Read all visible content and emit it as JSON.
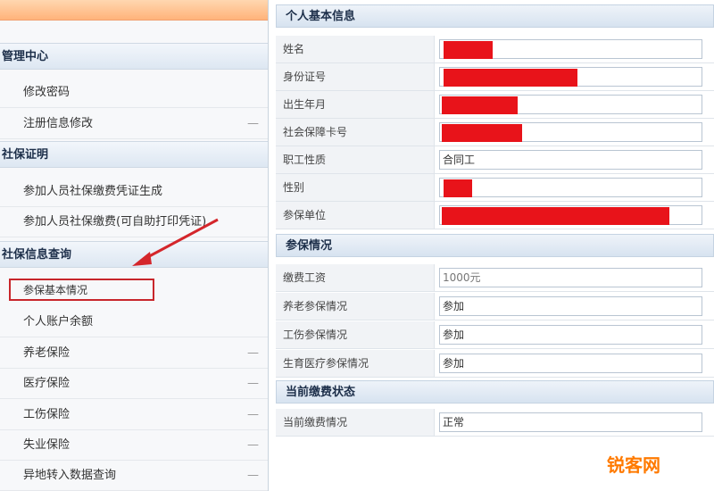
{
  "sidebar": {
    "sections": [
      {
        "title": "管理中心",
        "items": [
          {
            "label": "修改密码",
            "mark": ""
          },
          {
            "label": "注册信息修改",
            "mark": "—"
          }
        ]
      },
      {
        "title": "社保证明",
        "items": [
          {
            "label": "参加人员社保缴费凭证生成",
            "mark": ""
          },
          {
            "label": "参加人员社保缴费(可自助打印凭证)",
            "mark": ""
          }
        ]
      },
      {
        "title": "社保信息查询",
        "items": [
          {
            "label": "参保基本情况",
            "mark": ""
          },
          {
            "label": "个人账户余额",
            "mark": ""
          },
          {
            "label": "养老保险",
            "mark": "—"
          },
          {
            "label": "医疗保险",
            "mark": "—"
          },
          {
            "label": "工伤保险",
            "mark": "—"
          },
          {
            "label": "失业保险",
            "mark": "—"
          },
          {
            "label": "异地转入数据查询",
            "mark": "—"
          }
        ]
      }
    ]
  },
  "main": {
    "basic": {
      "title": "个人基本信息",
      "rows": [
        {
          "label": "姓名",
          "value": ""
        },
        {
          "label": "身份证号",
          "value": ""
        },
        {
          "label": "出生年月",
          "value": ""
        },
        {
          "label": "社会保障卡号",
          "value": ""
        },
        {
          "label": "职工性质",
          "value": "合同工"
        },
        {
          "label": "性别",
          "value": ""
        },
        {
          "label": "参保单位",
          "value": ""
        }
      ]
    },
    "insurance": {
      "title": "参保情况",
      "rows": [
        {
          "label": "缴费工资",
          "value": "1000元"
        },
        {
          "label": "养老参保情况",
          "value": "参加"
        },
        {
          "label": "工伤参保情况",
          "value": "参加"
        },
        {
          "label": "生育医疗参保情况",
          "value": "参加"
        }
      ]
    },
    "status": {
      "title": "当前缴费状态",
      "rows": [
        {
          "label": "当前缴费情况",
          "value": "正常"
        }
      ]
    }
  },
  "watermark": "锐客网",
  "colors": {
    "redaction": "#e8131a",
    "highlight": "#c8262b",
    "header_bg": "#dde7f2",
    "banner": "#ffb37a"
  }
}
